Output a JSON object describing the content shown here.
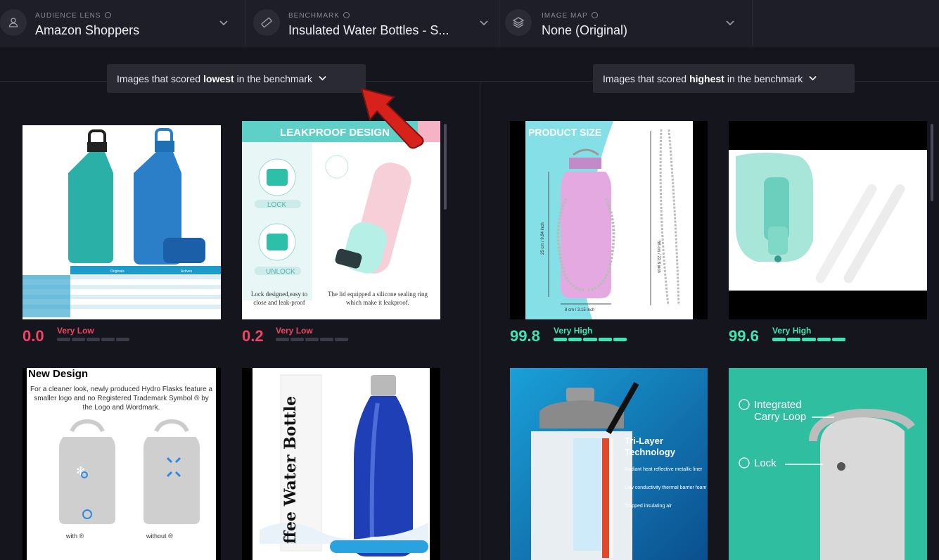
{
  "colors": {
    "low": "#ef4565",
    "high": "#3ee5b5",
    "seg_off": "#3b3b48"
  },
  "selectors": [
    {
      "label": "AUDIENCE LENS",
      "value": "Amazon Shoppers",
      "icon": "user-icon"
    },
    {
      "label": "BENCHMARK",
      "value": "Insulated Water Bottles - S...",
      "icon": "ruler-icon"
    },
    {
      "label": "IMAGE MAP",
      "value": "None (Original)",
      "icon": "layers-icon"
    }
  ],
  "lowest_filter": {
    "pre": "Images that scored",
    "bold": "lowest",
    "post": "in the benchmark"
  },
  "highest_filter": {
    "pre": "Images that scored",
    "bold": "highest",
    "post": "in the benchmark"
  },
  "cards": {
    "c1": {
      "score": "0.0",
      "rating": "Very Low",
      "level": 0.0,
      "table_headers": [
        "Originals",
        "Actives"
      ]
    },
    "c2": {
      "score": "0.2",
      "rating": "Very Low",
      "level": 0.002,
      "banner": "LEAKPROOF DESIGN",
      "lock": "LOCK",
      "unlock": "UNLOCK",
      "caption_left": "Lock designed,easy to close and leak-proof",
      "caption_right": "The lid equipped a silicone sealing ring which make it leakproof."
    },
    "c3": {
      "score": "99.8",
      "rating": "Very High",
      "level": 0.998,
      "banner": "PRODUCT SIZE",
      "dim_h": "25 cm / 9.84 inch",
      "dim_w": "8 cm / 3.15 inch",
      "dim_strap": "58 cm / 22.8 inch"
    },
    "c4": {
      "score": "99.6",
      "rating": "Very High",
      "level": 0.996
    },
    "c5": {
      "title": "New Design",
      "desc": "For a cleaner look, newly produced Hydro Flasks feature a smaller logo and no Registered Trademark Symbol ® by the Logo and Wordmark.",
      "with": "with ®",
      "without": "without ®"
    },
    "c6": {
      "box_text": "ffee Water Bottle"
    },
    "c7": {
      "title": "Tri-Layer Technology",
      "l1": "Radiant heat reflective metallic liner",
      "l2": "Low conductivity thermal barrier foam",
      "l3": "Trapped insulating air"
    },
    "c8": {
      "l1": "Integrated Carry Loop",
      "l2": "Lock"
    }
  }
}
